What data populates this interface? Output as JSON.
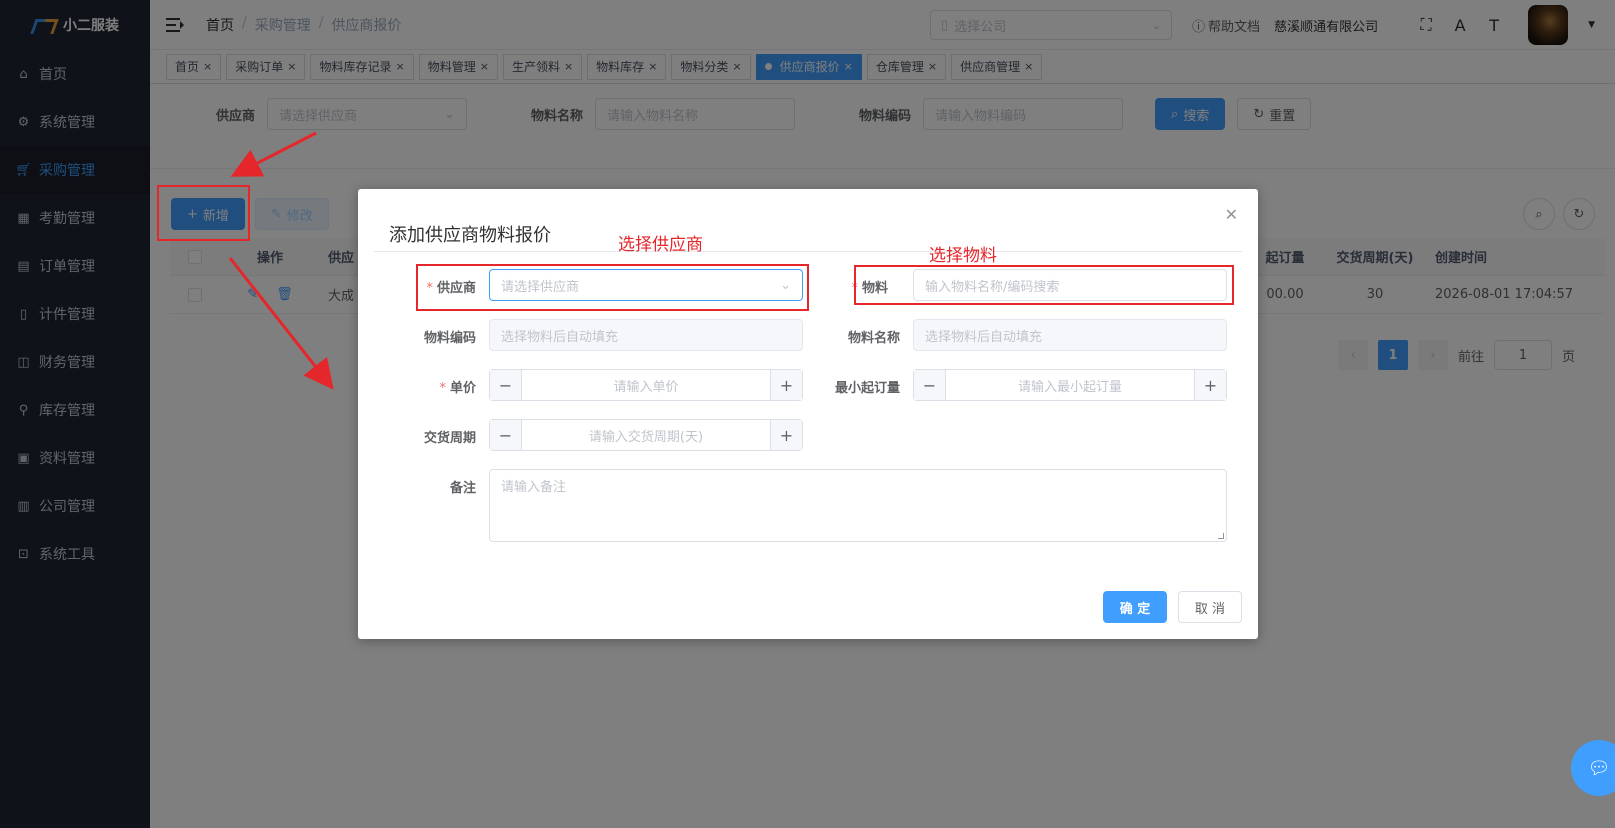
{
  "app": {
    "name": "小二服装"
  },
  "sidebar": {
    "items": [
      {
        "label": "首页",
        "icon": "dashboard-icon"
      },
      {
        "label": "系统管理",
        "icon": "gear-icon"
      },
      {
        "label": "采购管理",
        "icon": "cart-icon",
        "active": true
      },
      {
        "label": "考勤管理",
        "icon": "grid-icon"
      },
      {
        "label": "订单管理",
        "icon": "clipboard-icon"
      },
      {
        "label": "计件管理",
        "icon": "book-icon"
      },
      {
        "label": "财务管理",
        "icon": "chart-icon"
      },
      {
        "label": "库存管理",
        "icon": "user-icon"
      },
      {
        "label": "资料管理",
        "icon": "document-icon"
      },
      {
        "label": "公司管理",
        "icon": "bar-chart-icon"
      },
      {
        "label": "系统工具",
        "icon": "toolbox-icon"
      }
    ]
  },
  "navbar": {
    "breadcrumb": [
      "首页",
      "采购管理",
      "供应商报价"
    ],
    "company_placeholder": "选择公司",
    "help": "帮助文档",
    "company_name": "慈溪顺通有限公司"
  },
  "tags": [
    {
      "label": "首页"
    },
    {
      "label": "采购订单"
    },
    {
      "label": "物料库存记录"
    },
    {
      "label": "物料管理"
    },
    {
      "label": "生产领料"
    },
    {
      "label": "物料库存"
    },
    {
      "label": "物料分类"
    },
    {
      "label": "供应商报价",
      "active": true
    },
    {
      "label": "仓库管理"
    },
    {
      "label": "供应商管理"
    }
  ],
  "search": {
    "supplier_label": "供应商",
    "supplier_placeholder": "请选择供应商",
    "material_name_label": "物料名称",
    "material_name_placeholder": "请输入物料名称",
    "material_code_label": "物料编码",
    "material_code_placeholder": "请输入物料编码",
    "search_button": "搜索",
    "reset_button": "重置"
  },
  "toolbar": {
    "add_button": "新增",
    "edit_button": "修改"
  },
  "table": {
    "headers": {
      "ops": "操作",
      "supplier": "供应",
      "min_order": "起订量",
      "lead_time": "交货周期(天)",
      "created": "创建时间"
    },
    "row": {
      "supplier": "大成",
      "min_order": "00.00",
      "lead_time": "30",
      "created": "2026-08-01 17:04:57"
    }
  },
  "pagination": {
    "current": "1",
    "goto_label": "前往",
    "goto_value": "1",
    "page_unit": "页"
  },
  "dialog": {
    "title": "添加供应商物料报价",
    "supplier_label": "供应商",
    "supplier_placeholder": "请选择供应商",
    "material_label": "物料",
    "material_placeholder": "输入物料名称/编码搜索",
    "code_label": "物料编码",
    "code_placeholder": "选择物料后自动填充",
    "name_label": "物料名称",
    "name_placeholder": "选择物料后自动填充",
    "price_label": "单价",
    "price_placeholder": "请输入单价",
    "moq_label": "最小起订量",
    "moq_placeholder": "请输入最小起订量",
    "lead_label": "交货周期",
    "lead_placeholder": "请输入交货周期(天)",
    "remark_label": "备注",
    "remark_placeholder": "请输入备注",
    "confirm": "确 定",
    "cancel": "取 消"
  },
  "annotations": {
    "select_supplier": "选择供应商",
    "select_material": "选择物料",
    "color": "#e5262b"
  },
  "colors": {
    "primary": "#409eff",
    "sidebar_bg": "#1f2431",
    "danger": "#f56c6c"
  }
}
